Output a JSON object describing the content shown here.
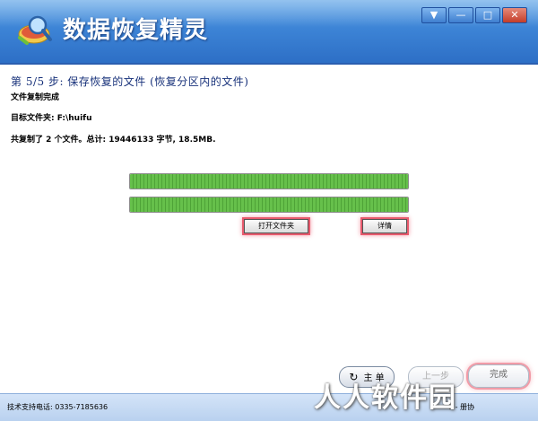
{
  "window": {
    "title": "数据恢复精灵",
    "controls": {
      "menu": "▼",
      "minimize": "—",
      "maximize": "□",
      "close": "✕"
    }
  },
  "step": {
    "title": "第 5/5 步: 保存恢复的文件 (恢复分区内的文件)",
    "subtitle": "文件复制完成"
  },
  "target_folder": "目标文件夹: F:\\huifu",
  "summary": "共复制了 2 个文件。总计: 19446133 字节, 18.5MB.",
  "progress": [
    {
      "fraction": 1.0
    },
    {
      "fraction": 1.0
    }
  ],
  "buttons": {
    "open_folder": "打开文件夹",
    "details": "详情",
    "main": "主 单",
    "previous": "上一步",
    "finish": "完成"
  },
  "statusbar": {
    "support": "技术支持电话: 0335-7185636",
    "extra": "1 -  册协"
  },
  "watermark": "人人软件园",
  "colors": {
    "accent": "#2d6fc6",
    "progress": "#66c04b",
    "highlight": "#e85a6d"
  },
  "icons": {
    "logo": "magnifier-disk-icon",
    "refresh": "refresh-icon"
  }
}
